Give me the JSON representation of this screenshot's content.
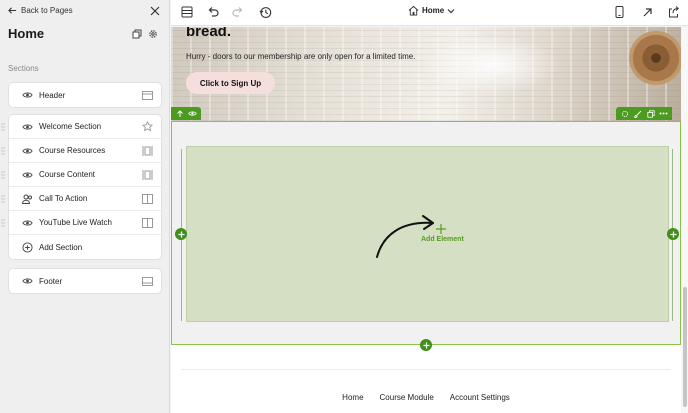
{
  "sidebar": {
    "back_label": "Back to Pages",
    "page_title": "Home",
    "sections_label": "Sections",
    "header_item": {
      "label": "Header",
      "icon": "eye-icon",
      "right_icon": "header-layout-icon"
    },
    "items": [
      {
        "label": "Welcome Section",
        "icon": "eye-icon",
        "right_icon": "star-icon"
      },
      {
        "label": "Course Resources",
        "icon": "eye-icon",
        "right_icon": "columns-icon"
      },
      {
        "label": "Course Content",
        "icon": "eye-icon",
        "right_icon": "columns-icon"
      },
      {
        "label": "Call To Action",
        "icon": "users-icon",
        "right_icon": "layout-icon"
      },
      {
        "label": "YouTube Live Watch",
        "icon": "eye-icon",
        "right_icon": "layout-icon"
      },
      {
        "label": "Add Section",
        "icon": "plus-circle-icon"
      }
    ],
    "footer_item": {
      "label": "Footer",
      "icon": "eye-icon",
      "right_icon": "footer-layout-icon"
    }
  },
  "toolbar": {
    "page_name": "Home"
  },
  "canvas": {
    "hero": {
      "heading": "bread.",
      "text": "Hurry - doors to our membership are only open for a limited time.",
      "cta_label": "Click to Sign Up"
    },
    "add_element_label": "Add Element",
    "footer_links": [
      "Home",
      "Course Module",
      "Account Settings"
    ]
  },
  "colors": {
    "accent_green": "#3f8f1b",
    "drop_zone": "#d4dfc4",
    "cta_bg": "#f4dfdc"
  }
}
